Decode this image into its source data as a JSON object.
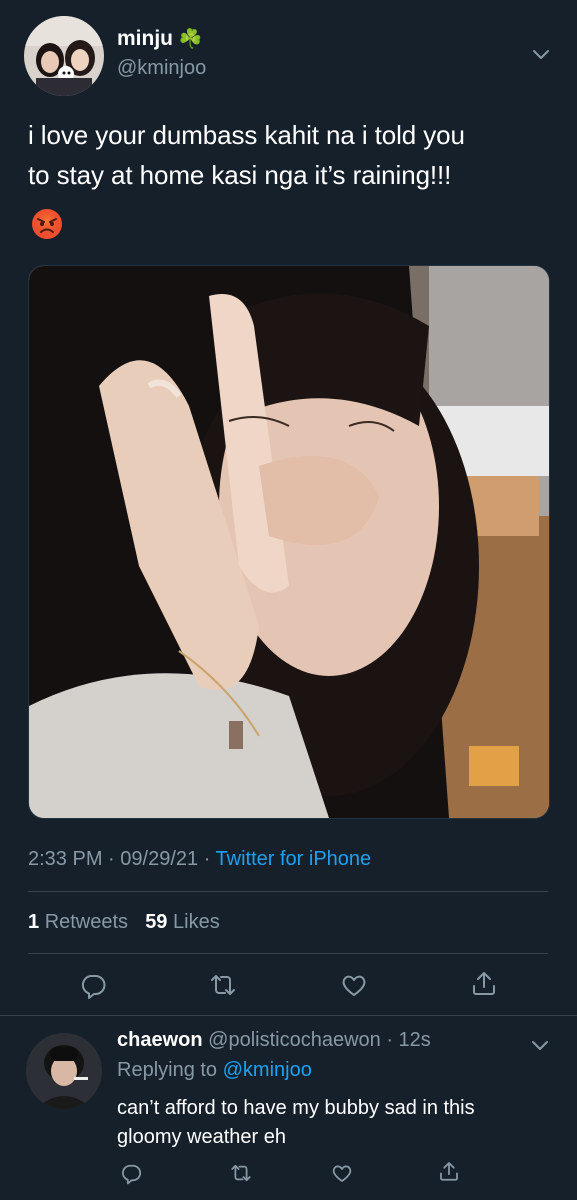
{
  "tweet": {
    "author_name": "minju",
    "author_emoji": "☘️",
    "author_handle": "@kminjoo",
    "text_line1": "i love your dumbass kahit na i told you",
    "text_line2": "to stay at home kasi nga it’s raining!!!",
    "text_emoji": "😡",
    "time": "2:33 PM",
    "date": "09/29/21",
    "source": "Twitter for iPhone",
    "retweets_count": "1",
    "retweets_label": "Retweets",
    "likes_count": "59",
    "likes_label": "Likes"
  },
  "reply": {
    "author_name": "chaewon",
    "author_handle": "@polisticochaewon",
    "time": "12s",
    "replying_prefix": "Replying to",
    "replying_handle": "@kminjoo",
    "text_line1": "can’t afford to have my bubby sad in this",
    "text_line2": "gloomy weather eh"
  },
  "icons": {
    "reply": "reply-icon",
    "retweet": "retweet-icon",
    "like": "heart-icon",
    "share": "share-icon",
    "more": "chevron-down-icon"
  },
  "colors": {
    "background": "#15202b",
    "muted": "#8899a6",
    "link": "#1da1f2",
    "divider": "#38444d"
  }
}
